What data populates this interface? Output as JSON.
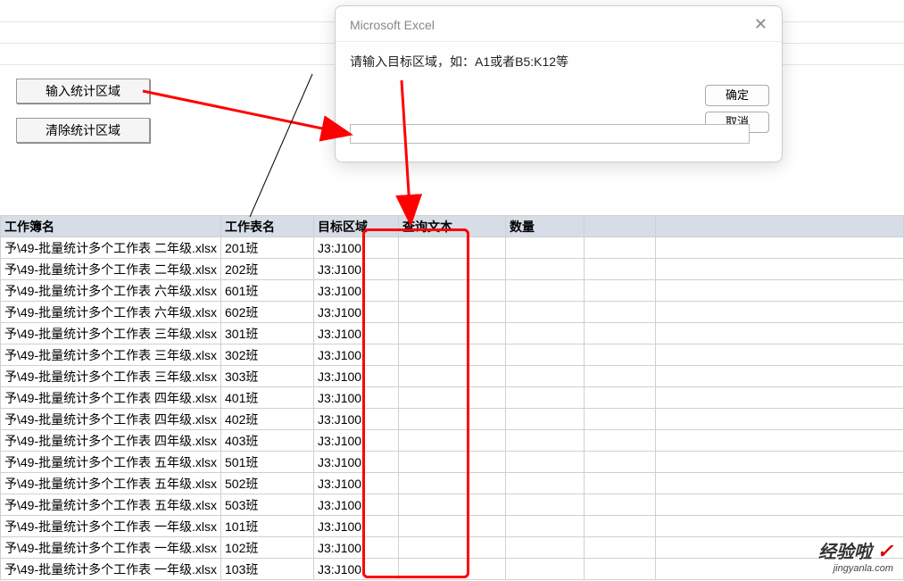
{
  "buttons": {
    "input_area": "输入统计区域",
    "clear_area": "清除统计区域"
  },
  "dialog": {
    "title": "Microsoft Excel",
    "prompt": "请输入目标区域，如：A1或者B5:K12等",
    "ok": "确定",
    "cancel": "取消",
    "input_value": ""
  },
  "headers": {
    "workbook": "工作簿名",
    "worksheet": "工作表名",
    "target_range": "目标区域",
    "query_text": "查询文本",
    "count": "数量"
  },
  "rows": [
    {
      "wb": "予\\49-批量统计多个工作表 二年级.xlsx",
      "ws": "201班",
      "range": "J3:J100"
    },
    {
      "wb": "予\\49-批量统计多个工作表 二年级.xlsx",
      "ws": "202班",
      "range": "J3:J100"
    },
    {
      "wb": "予\\49-批量统计多个工作表 六年级.xlsx",
      "ws": "601班",
      "range": "J3:J100"
    },
    {
      "wb": "予\\49-批量统计多个工作表 六年级.xlsx",
      "ws": "602班",
      "range": "J3:J100"
    },
    {
      "wb": "予\\49-批量统计多个工作表 三年级.xlsx",
      "ws": "301班",
      "range": "J3:J100"
    },
    {
      "wb": "予\\49-批量统计多个工作表 三年级.xlsx",
      "ws": "302班",
      "range": "J3:J100"
    },
    {
      "wb": "予\\49-批量统计多个工作表 三年级.xlsx",
      "ws": "303班",
      "range": "J3:J100"
    },
    {
      "wb": "予\\49-批量统计多个工作表 四年级.xlsx",
      "ws": "401班",
      "range": "J3:J100"
    },
    {
      "wb": "予\\49-批量统计多个工作表 四年级.xlsx",
      "ws": "402班",
      "range": "J3:J100"
    },
    {
      "wb": "予\\49-批量统计多个工作表 四年级.xlsx",
      "ws": "403班",
      "range": "J3:J100"
    },
    {
      "wb": "予\\49-批量统计多个工作表 五年级.xlsx",
      "ws": "501班",
      "range": "J3:J100"
    },
    {
      "wb": "予\\49-批量统计多个工作表 五年级.xlsx",
      "ws": "502班",
      "range": "J3:J100"
    },
    {
      "wb": "予\\49-批量统计多个工作表 五年级.xlsx",
      "ws": "503班",
      "range": "J3:J100"
    },
    {
      "wb": "予\\49-批量统计多个工作表 一年级.xlsx",
      "ws": "101班",
      "range": "J3:J100"
    },
    {
      "wb": "予\\49-批量统计多个工作表 一年级.xlsx",
      "ws": "102班",
      "range": "J3:J100"
    },
    {
      "wb": "予\\49-批量统计多个工作表 一年级.xlsx",
      "ws": "103班",
      "range": "J3:J100"
    }
  ],
  "watermark": {
    "top": "经验啦",
    "bottom": "jingyanla.com"
  }
}
